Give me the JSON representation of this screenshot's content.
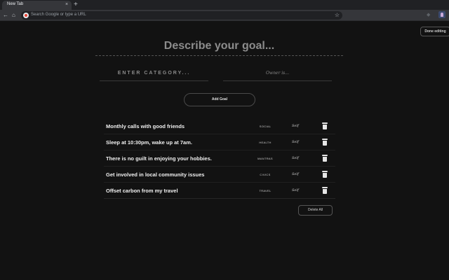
{
  "browser": {
    "tab_title": "New Tab",
    "tab_close": "×",
    "new_tab": "+",
    "omnibox_placeholder": "Search Google or type a URL",
    "back": "←",
    "forward": "→",
    "reload": "↻",
    "home": "⌂",
    "star": "☆",
    "ext": "◆"
  },
  "page": {
    "done_editing": "Done editing",
    "goal_placeholder": "Describe your goal...",
    "category_placeholder": "ENTER CATEGORY...",
    "owner_placeholder": "Owner is...",
    "add_goal": "Add Goal",
    "delete_all": "Delete All"
  },
  "goals": [
    {
      "text": "Monthly calls with good friends",
      "category": "SOCIAL",
      "owner": "Self"
    },
    {
      "text": "Sleep at 10:30pm, wake up at 7am.",
      "category": "HEALTH",
      "owner": "Self"
    },
    {
      "text": "There is no guilt in enjoying your hobbies.",
      "category": "MANTRAS",
      "owner": "Self"
    },
    {
      "text": "Get involved in local community issues",
      "category": "CIVICS",
      "owner": "Self"
    },
    {
      "text": "Offset carbon from my travel",
      "category": "TRAVEL",
      "owner": "Self"
    }
  ]
}
